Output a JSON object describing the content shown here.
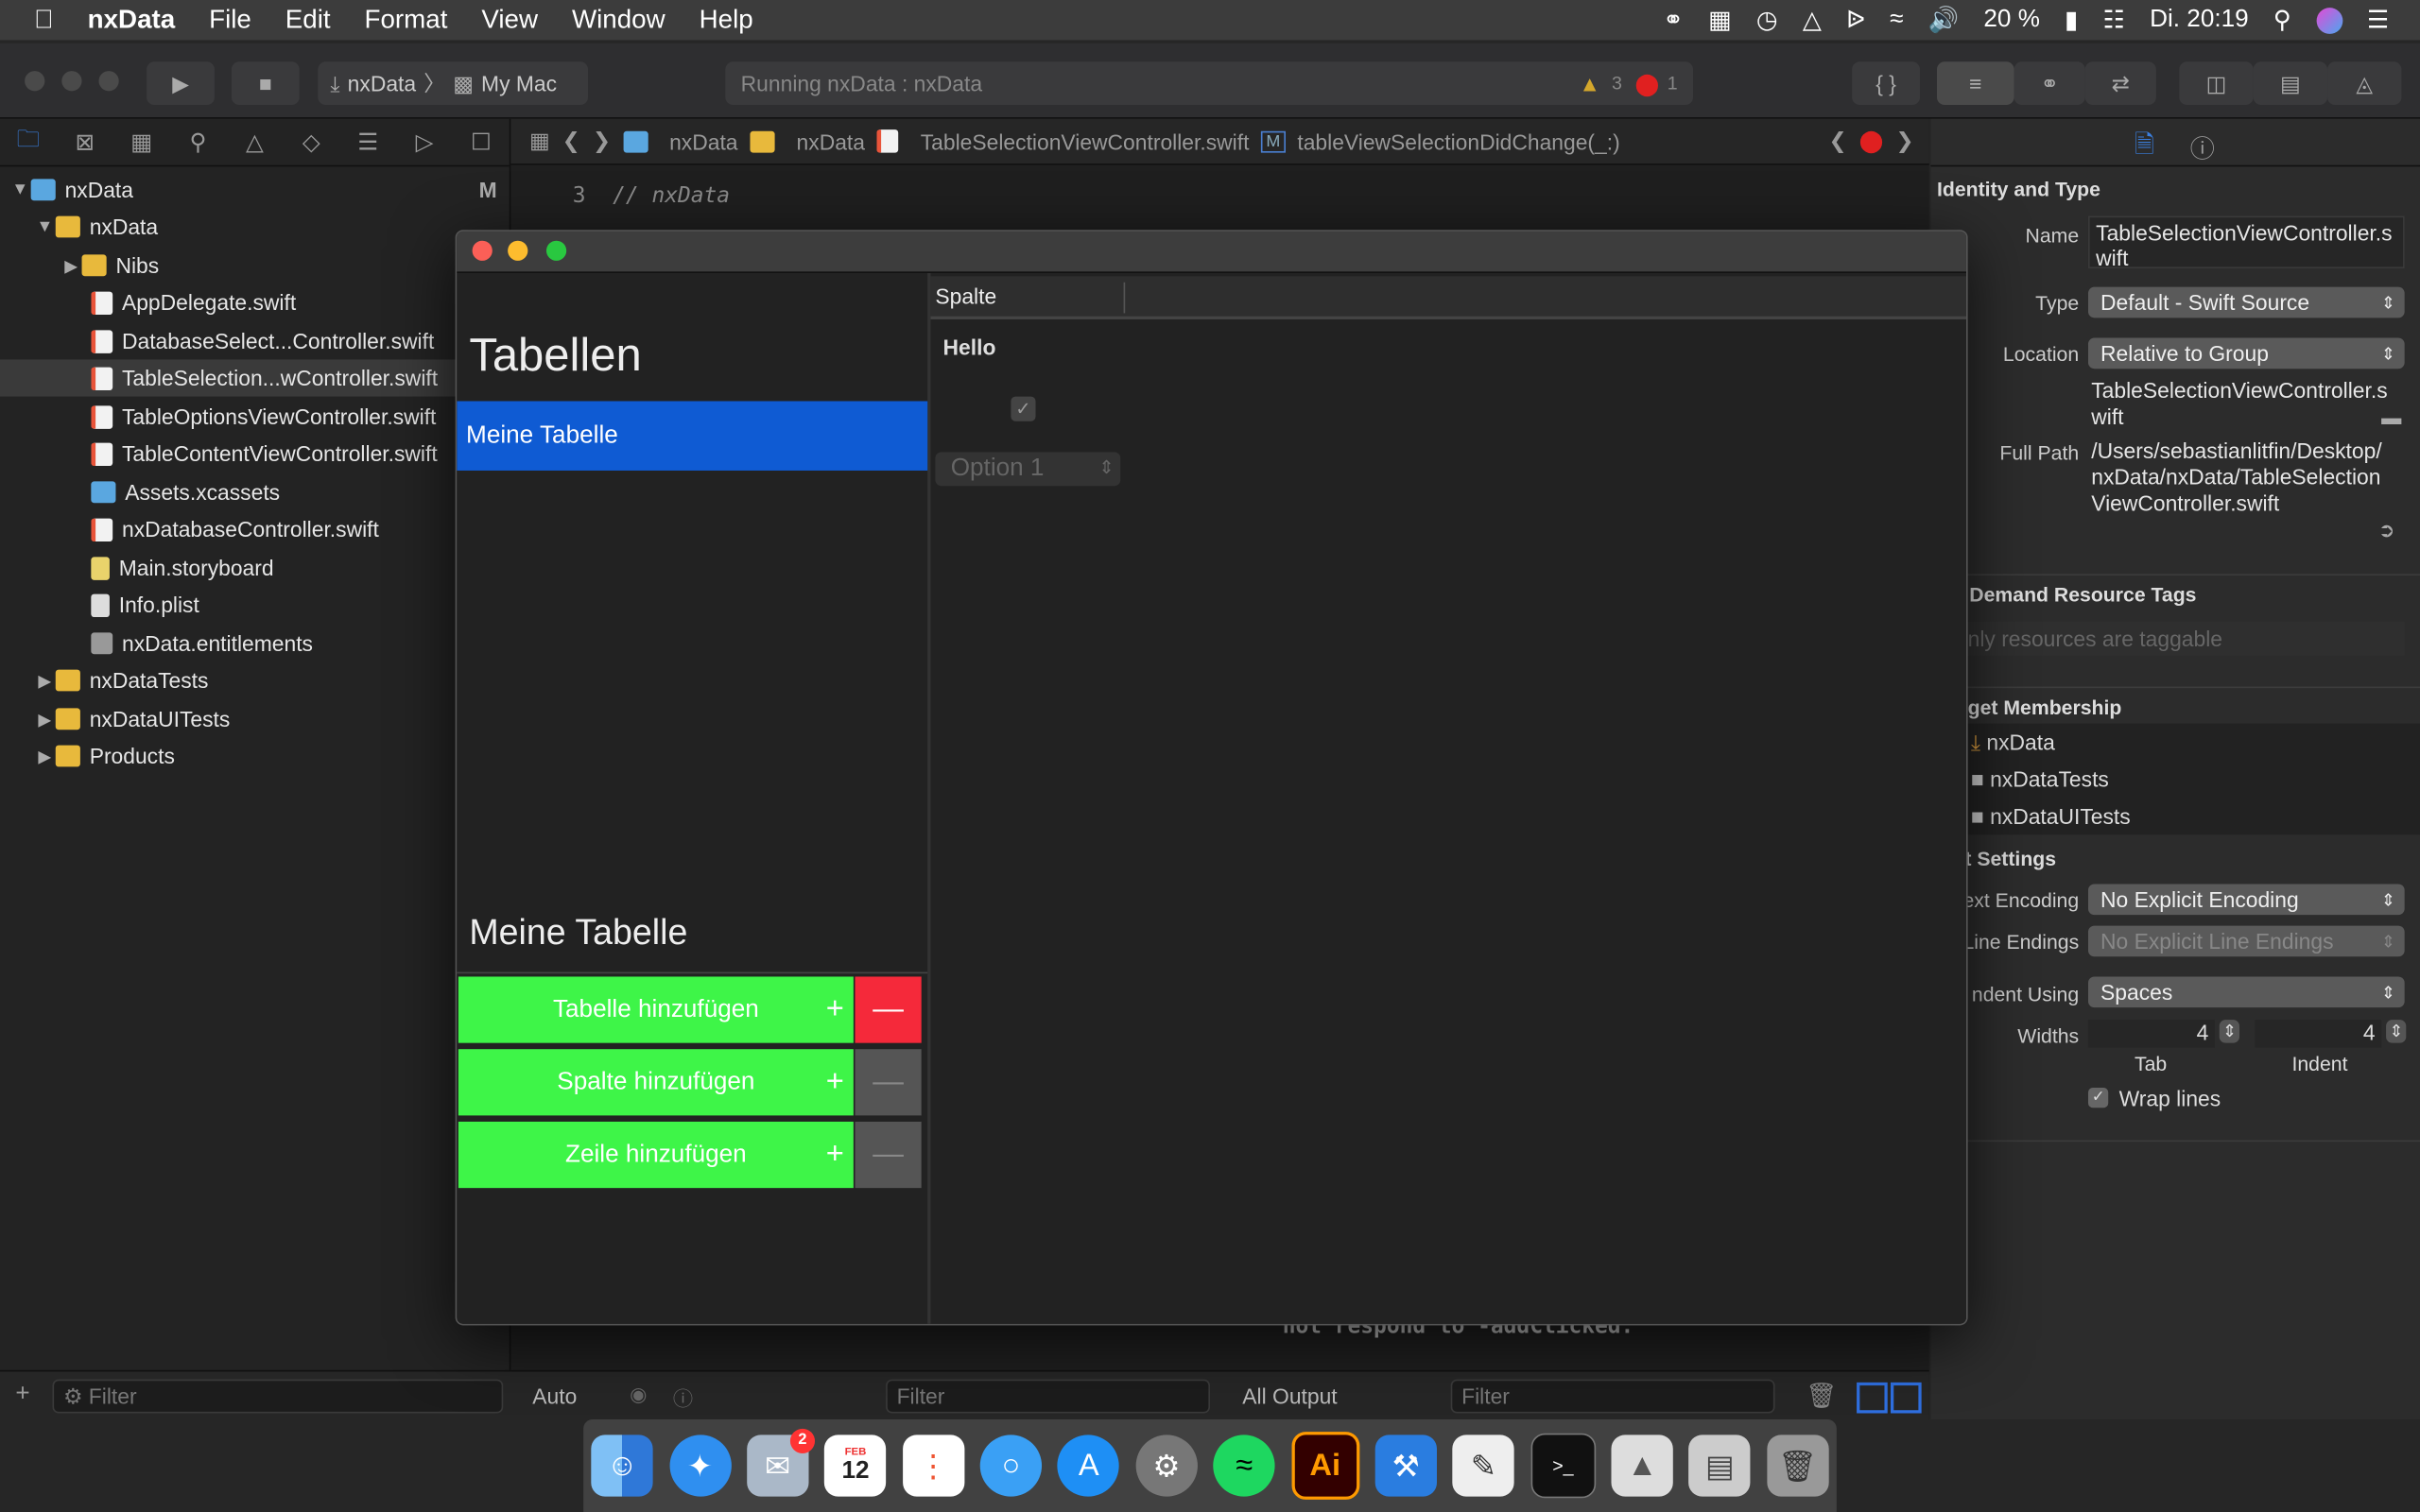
{
  "menubar": {
    "app": "nxData",
    "items": [
      "File",
      "Edit",
      "Format",
      "View",
      "Window",
      "Help"
    ],
    "battery": "20 %",
    "clock": "Di. 20:19"
  },
  "toolbar": {
    "scheme": "nxData",
    "destination": "My Mac",
    "activity": "Running nxData : nxData",
    "warnings": "3",
    "errors": "1"
  },
  "navigator": {
    "items": [
      {
        "label": "nxData",
        "badge": "M"
      },
      {
        "label": "nxData"
      },
      {
        "label": "Nibs"
      },
      {
        "label": "AppDelegate.swift"
      },
      {
        "label": "DatabaseSelect...Controller.swift"
      },
      {
        "label": "TableSelection...wController.swift"
      },
      {
        "label": "TableOptionsViewController.swift"
      },
      {
        "label": "TableContentViewController.swift"
      },
      {
        "label": "Assets.xcassets"
      },
      {
        "label": "nxDatabaseController.swift"
      },
      {
        "label": "Main.storyboard"
      },
      {
        "label": "Info.plist"
      },
      {
        "label": "nxData.entitlements"
      },
      {
        "label": "nxDataTests"
      },
      {
        "label": "nxDataUITests"
      },
      {
        "label": "Products"
      }
    ],
    "filter_placeholder": "Filter"
  },
  "jumpbar": {
    "items": [
      "nxData",
      "nxData",
      "TableSelectionViewController.swift",
      "tableViewSelectionDidChange(_:)"
    ]
  },
  "editor": {
    "line_number": "3",
    "line_text": "//  nxData",
    "console_text": "not respond to -addClicked."
  },
  "bottombar": {
    "auto": "Auto",
    "filter1": "Filter",
    "output": "All Output",
    "filter2": "Filter"
  },
  "inspector": {
    "identity_title": "Identity and Type",
    "name_label": "Name",
    "name_value": "TableSelectionViewController.swift",
    "type_label": "Type",
    "type_value": "Default - Swift Source",
    "location_label": "Location",
    "location_value": "Relative to Group",
    "location_file": "TableSelectionViewController.swift",
    "fullpath_label": "Full Path",
    "fullpath_value": "/Users/sebastianlitfin/Desktop/nxData/nxData/TableSelectionViewController.swift",
    "odr_title": "Demand Resource Tags",
    "odr_placeholder": "nly resources are taggable",
    "target_title": "get Membership",
    "targets": [
      "nxData",
      "nxDataTests",
      "nxDataUITests"
    ],
    "text_title": "t Settings",
    "encoding_label": "ext Encoding",
    "encoding_value": "No Explicit Encoding",
    "endings_label": "Line Endings",
    "endings_value": "No Explicit Line Endings",
    "indent_label": "ndent Using",
    "indent_value": "Spaces",
    "widths_label": "Widths",
    "tab_value": "4",
    "tab_label": "Tab",
    "indent_width_value": "4",
    "indent_width_label": "Indent",
    "wrap_label": "Wrap lines",
    "wrap_checked": true
  },
  "app_window": {
    "tables_title": "Tabellen",
    "tables": [
      "Meine Tabelle"
    ],
    "selected_table": "Meine Tabelle",
    "column_header": "Spalte",
    "cell_text": "Hello",
    "checkbox_checked": true,
    "popup_value": "Option 1",
    "add_table": "Tabelle hinzufügen",
    "add_column": "Spalte hinzufügen",
    "add_row": "Zeile hinzufügen",
    "plus": "+",
    "minus": "—",
    "colors": {
      "accent": "#0f5bd3",
      "add": "#3ef548",
      "remove": "#f5293a"
    }
  },
  "dock": {
    "items": [
      "finder",
      "safari",
      "mail",
      "calendar",
      "reminders",
      "messages",
      "app-store",
      "system-preferences",
      "spotify",
      "illustrator",
      "xcode",
      "textedit",
      "terminal",
      "preview",
      "archive",
      "trash"
    ],
    "mail_badge": "2",
    "calendar_month": "FEB",
    "calendar_day": "12",
    "illustrator_label": "Ai"
  }
}
